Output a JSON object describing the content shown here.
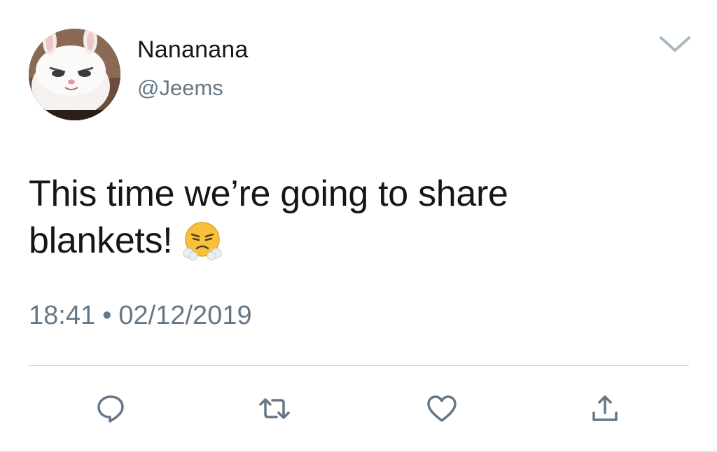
{
  "user": {
    "display_name": "Nananana",
    "handle": "@Jeems",
    "avatar_icon": "white-rabbit-avatar"
  },
  "tweet": {
    "line1": "This time we’re going to share",
    "line2": "blankets!",
    "emoji": "face-with-steam-from-nose-emoji"
  },
  "meta": {
    "time": "18:41",
    "separator": "•",
    "date": "02/12/2019"
  },
  "actions": {
    "reply_icon": "reply-icon",
    "retweet_icon": "retweet-icon",
    "like_icon": "heart-icon",
    "share_icon": "share-icon"
  },
  "colors": {
    "text": "#14171a",
    "secondary": "#657786",
    "icon": "#657786",
    "divider": "#ccd6dd"
  }
}
